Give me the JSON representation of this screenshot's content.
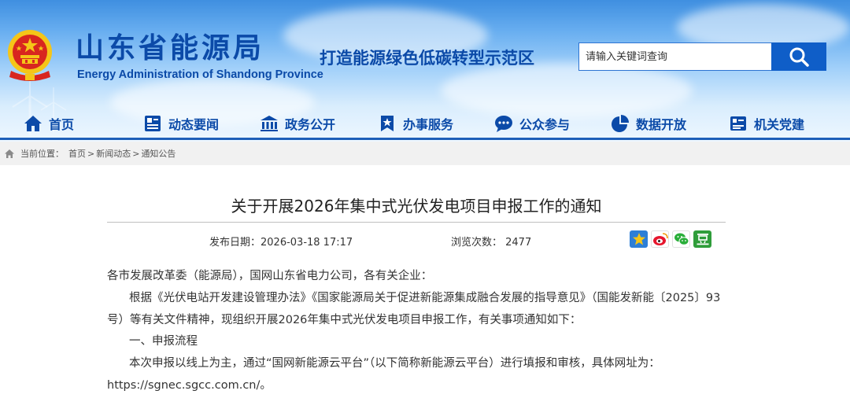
{
  "header": {
    "title": "山东省能源局",
    "subtitle": "Energy Administration of Shandong Province",
    "slogan": "打造能源绿色低碳转型示范区",
    "search_placeholder": "请输入关键词查询",
    "brand_color": "#0b4aa8",
    "search_icon": "search-icon"
  },
  "nav": {
    "items": [
      {
        "label": "首页",
        "icon": "home-icon"
      },
      {
        "label": "动态要闻",
        "icon": "news-icon"
      },
      {
        "label": "政务公开",
        "icon": "government-icon"
      },
      {
        "label": "办事服务",
        "icon": "service-icon"
      },
      {
        "label": "公众参与",
        "icon": "chat-icon"
      },
      {
        "label": "数据开放",
        "icon": "pie-chart-icon"
      },
      {
        "label": "机关党建",
        "icon": "party-icon"
      }
    ]
  },
  "breadcrumb": {
    "prefix": "当前位置：",
    "items": [
      "首页",
      "新闻动态",
      "通知公告"
    ],
    "separator": ">"
  },
  "article": {
    "title": "关于开展2026年集中式光伏发电项目申报工作的通知",
    "publish_label": "发布日期：2026-03-18 17:17",
    "views_label": "浏览次数：  2477",
    "share_icons": [
      "qzone-icon",
      "weibo-icon",
      "wechat-icon",
      "douban-icon"
    ],
    "paragraphs": [
      "各市发展改革委（能源局），国网山东省电力公司，各有关企业：",
      "根据《光伏电站开发建设管理办法》《国家能源局关于促进新能源集成融合发展的指导意见》（国能发新能〔2025〕93",
      "号）等有关文件精神，现组织开展2026年集中式光伏发电项目申报工作，有关事项通知如下：",
      "一、申报流程",
      "本次申报以线上为主，通过“国网新能源云平台”（以下简称新能源云平台）进行填报和审核，具体网址为：",
      "https://sgnec.sgcc.com.cn/。"
    ]
  }
}
